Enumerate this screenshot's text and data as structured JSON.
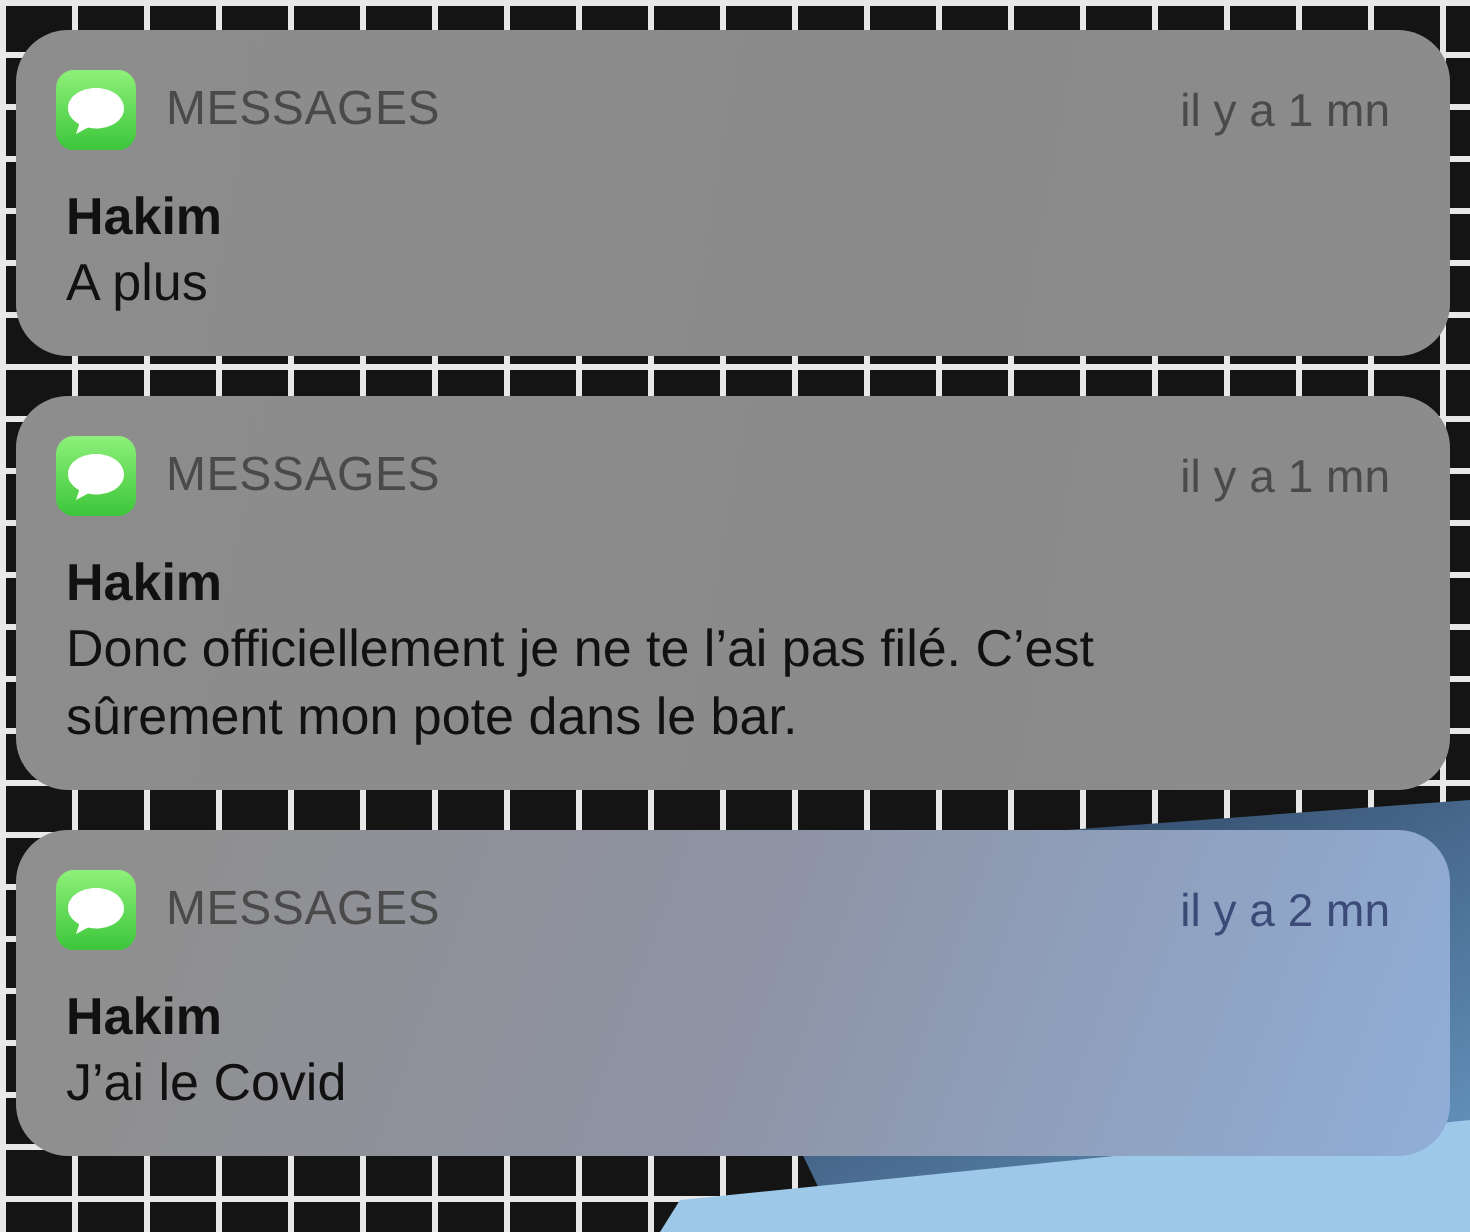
{
  "notifications": [
    {
      "app": "MESSAGES",
      "time": "il y a 1 mn",
      "title": "Hakim",
      "body": "A plus"
    },
    {
      "app": "MESSAGES",
      "time": "il y a 1 mn",
      "title": "Hakim",
      "body": "Donc officiellement je ne te l’ai pas filé. C’est sûrement mon pote dans le bar."
    },
    {
      "app": "MESSAGES",
      "time": "il y a 2 mn",
      "title": "Hakim",
      "body": "J’ai le Covid"
    }
  ]
}
